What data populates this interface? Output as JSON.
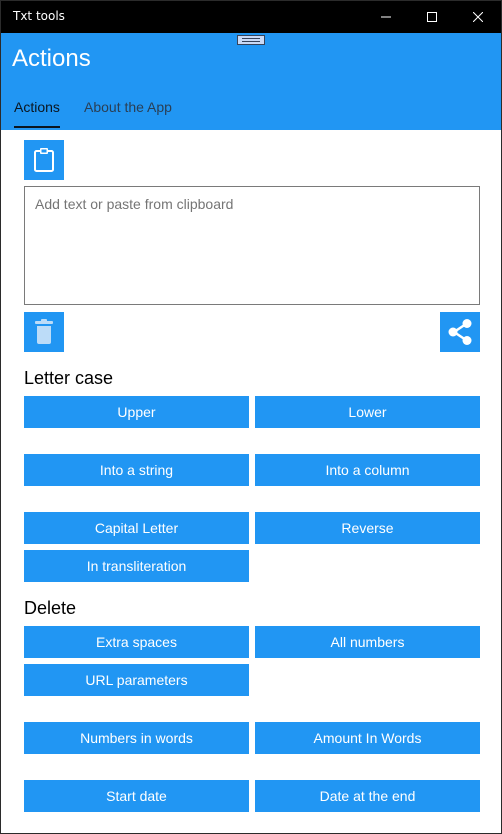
{
  "window": {
    "title": "Txt tools"
  },
  "header": {
    "title": "Actions",
    "tabs": [
      {
        "label": "Actions"
      },
      {
        "label": "About the App"
      }
    ]
  },
  "editor": {
    "placeholder": "Add text or paste from clipboard"
  },
  "sections": {
    "letter_case": {
      "title": "Letter case",
      "buttons": [
        "Upper",
        "Lower",
        "Into a string",
        "Into a column",
        "Capital Letter",
        "Reverse",
        "In transliteration"
      ]
    },
    "delete": {
      "title": "Delete",
      "buttons": [
        "Extra spaces",
        "All numbers",
        "URL parameters",
        "Numbers in words",
        "Amount In Words",
        "Start date",
        "Date at the end"
      ]
    }
  },
  "colors": {
    "accent": "#2196f3",
    "titlebar": "#000000"
  }
}
